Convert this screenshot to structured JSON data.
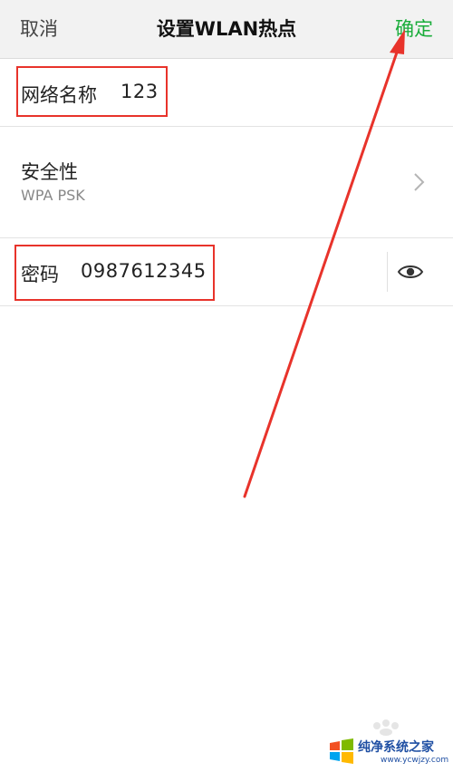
{
  "header": {
    "cancel_label": "取消",
    "title": "设置WLAN热点",
    "confirm_label": "确定"
  },
  "network_name": {
    "label": "网络名称",
    "value": "123"
  },
  "security": {
    "label": "安全性",
    "value": "WPA PSK",
    "icon": "chevron-right-icon"
  },
  "password": {
    "label": "密码",
    "value": "0987612345",
    "icon": "eye-icon"
  },
  "watermark": {
    "title": "纯净系统之家",
    "url": "www.ycwjzy.com"
  },
  "colors": {
    "accent": "#1aad3b",
    "annotation": "#e8332b",
    "watermark": "#1f4fa3"
  }
}
